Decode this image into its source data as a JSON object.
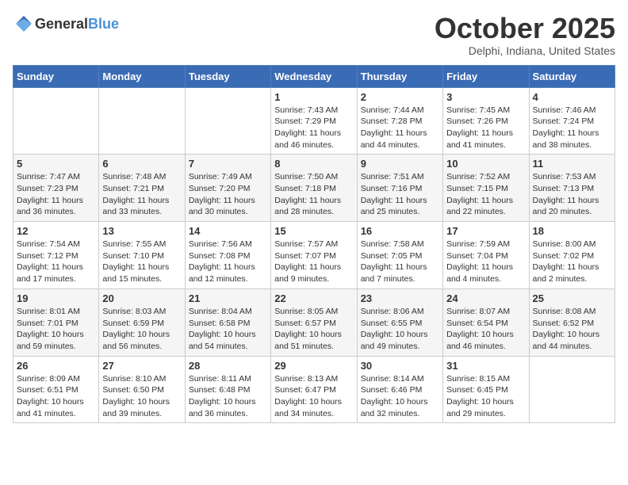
{
  "header": {
    "logo_general": "General",
    "logo_blue": "Blue",
    "month": "October 2025",
    "location": "Delphi, Indiana, United States"
  },
  "weekdays": [
    "Sunday",
    "Monday",
    "Tuesday",
    "Wednesday",
    "Thursday",
    "Friday",
    "Saturday"
  ],
  "weeks": [
    [
      {
        "day": "",
        "info": ""
      },
      {
        "day": "",
        "info": ""
      },
      {
        "day": "",
        "info": ""
      },
      {
        "day": "1",
        "info": "Sunrise: 7:43 AM\nSunset: 7:29 PM\nDaylight: 11 hours and 46 minutes."
      },
      {
        "day": "2",
        "info": "Sunrise: 7:44 AM\nSunset: 7:28 PM\nDaylight: 11 hours and 44 minutes."
      },
      {
        "day": "3",
        "info": "Sunrise: 7:45 AM\nSunset: 7:26 PM\nDaylight: 11 hours and 41 minutes."
      },
      {
        "day": "4",
        "info": "Sunrise: 7:46 AM\nSunset: 7:24 PM\nDaylight: 11 hours and 38 minutes."
      }
    ],
    [
      {
        "day": "5",
        "info": "Sunrise: 7:47 AM\nSunset: 7:23 PM\nDaylight: 11 hours and 36 minutes."
      },
      {
        "day": "6",
        "info": "Sunrise: 7:48 AM\nSunset: 7:21 PM\nDaylight: 11 hours and 33 minutes."
      },
      {
        "day": "7",
        "info": "Sunrise: 7:49 AM\nSunset: 7:20 PM\nDaylight: 11 hours and 30 minutes."
      },
      {
        "day": "8",
        "info": "Sunrise: 7:50 AM\nSunset: 7:18 PM\nDaylight: 11 hours and 28 minutes."
      },
      {
        "day": "9",
        "info": "Sunrise: 7:51 AM\nSunset: 7:16 PM\nDaylight: 11 hours and 25 minutes."
      },
      {
        "day": "10",
        "info": "Sunrise: 7:52 AM\nSunset: 7:15 PM\nDaylight: 11 hours and 22 minutes."
      },
      {
        "day": "11",
        "info": "Sunrise: 7:53 AM\nSunset: 7:13 PM\nDaylight: 11 hours and 20 minutes."
      }
    ],
    [
      {
        "day": "12",
        "info": "Sunrise: 7:54 AM\nSunset: 7:12 PM\nDaylight: 11 hours and 17 minutes."
      },
      {
        "day": "13",
        "info": "Sunrise: 7:55 AM\nSunset: 7:10 PM\nDaylight: 11 hours and 15 minutes."
      },
      {
        "day": "14",
        "info": "Sunrise: 7:56 AM\nSunset: 7:08 PM\nDaylight: 11 hours and 12 minutes."
      },
      {
        "day": "15",
        "info": "Sunrise: 7:57 AM\nSunset: 7:07 PM\nDaylight: 11 hours and 9 minutes."
      },
      {
        "day": "16",
        "info": "Sunrise: 7:58 AM\nSunset: 7:05 PM\nDaylight: 11 hours and 7 minutes."
      },
      {
        "day": "17",
        "info": "Sunrise: 7:59 AM\nSunset: 7:04 PM\nDaylight: 11 hours and 4 minutes."
      },
      {
        "day": "18",
        "info": "Sunrise: 8:00 AM\nSunset: 7:02 PM\nDaylight: 11 hours and 2 minutes."
      }
    ],
    [
      {
        "day": "19",
        "info": "Sunrise: 8:01 AM\nSunset: 7:01 PM\nDaylight: 10 hours and 59 minutes."
      },
      {
        "day": "20",
        "info": "Sunrise: 8:03 AM\nSunset: 6:59 PM\nDaylight: 10 hours and 56 minutes."
      },
      {
        "day": "21",
        "info": "Sunrise: 8:04 AM\nSunset: 6:58 PM\nDaylight: 10 hours and 54 minutes."
      },
      {
        "day": "22",
        "info": "Sunrise: 8:05 AM\nSunset: 6:57 PM\nDaylight: 10 hours and 51 minutes."
      },
      {
        "day": "23",
        "info": "Sunrise: 8:06 AM\nSunset: 6:55 PM\nDaylight: 10 hours and 49 minutes."
      },
      {
        "day": "24",
        "info": "Sunrise: 8:07 AM\nSunset: 6:54 PM\nDaylight: 10 hours and 46 minutes."
      },
      {
        "day": "25",
        "info": "Sunrise: 8:08 AM\nSunset: 6:52 PM\nDaylight: 10 hours and 44 minutes."
      }
    ],
    [
      {
        "day": "26",
        "info": "Sunrise: 8:09 AM\nSunset: 6:51 PM\nDaylight: 10 hours and 41 minutes."
      },
      {
        "day": "27",
        "info": "Sunrise: 8:10 AM\nSunset: 6:50 PM\nDaylight: 10 hours and 39 minutes."
      },
      {
        "day": "28",
        "info": "Sunrise: 8:11 AM\nSunset: 6:48 PM\nDaylight: 10 hours and 36 minutes."
      },
      {
        "day": "29",
        "info": "Sunrise: 8:13 AM\nSunset: 6:47 PM\nDaylight: 10 hours and 34 minutes."
      },
      {
        "day": "30",
        "info": "Sunrise: 8:14 AM\nSunset: 6:46 PM\nDaylight: 10 hours and 32 minutes."
      },
      {
        "day": "31",
        "info": "Sunrise: 8:15 AM\nSunset: 6:45 PM\nDaylight: 10 hours and 29 minutes."
      },
      {
        "day": "",
        "info": ""
      }
    ]
  ]
}
